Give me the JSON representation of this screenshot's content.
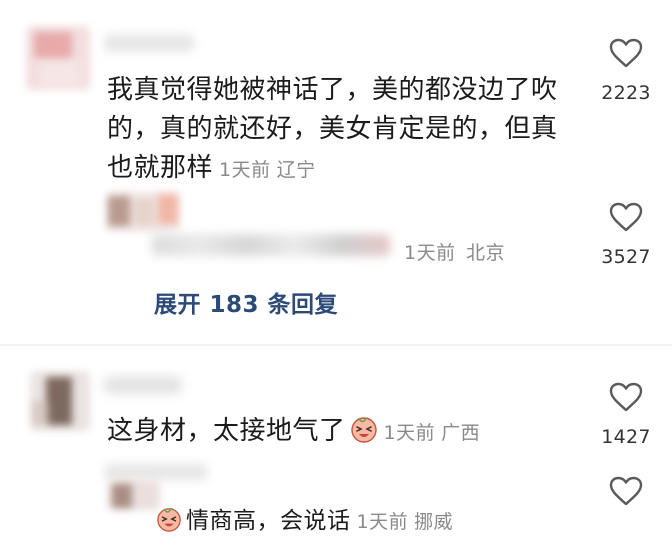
{
  "comments": [
    {
      "text_lines": [
        "我真觉得她被神话了，美的都没边了吹",
        "的，真的就还好，美女肯定是的，但真",
        "也就那样"
      ],
      "time": "1天前",
      "location": "辽宁",
      "likes": "2223",
      "reply": {
        "time": "1天前",
        "location": "北京",
        "likes": "3527"
      },
      "expand_label": "展开 183 条回复"
    },
    {
      "text": "这身材，太接地气了",
      "emoji": "laughing-sweat-emoji",
      "time": "1天前",
      "location": "广西",
      "likes": "1427",
      "reply": {
        "text": "情商高，会说话",
        "time": "1天前",
        "location": "挪威"
      }
    }
  ],
  "icons": {
    "like": "heart-outline-icon"
  },
  "colors": {
    "text": "#1b1b1b",
    "meta": "#8a8a8a",
    "expand_link": "#2c4a78",
    "divider": "#f0f0f0"
  }
}
